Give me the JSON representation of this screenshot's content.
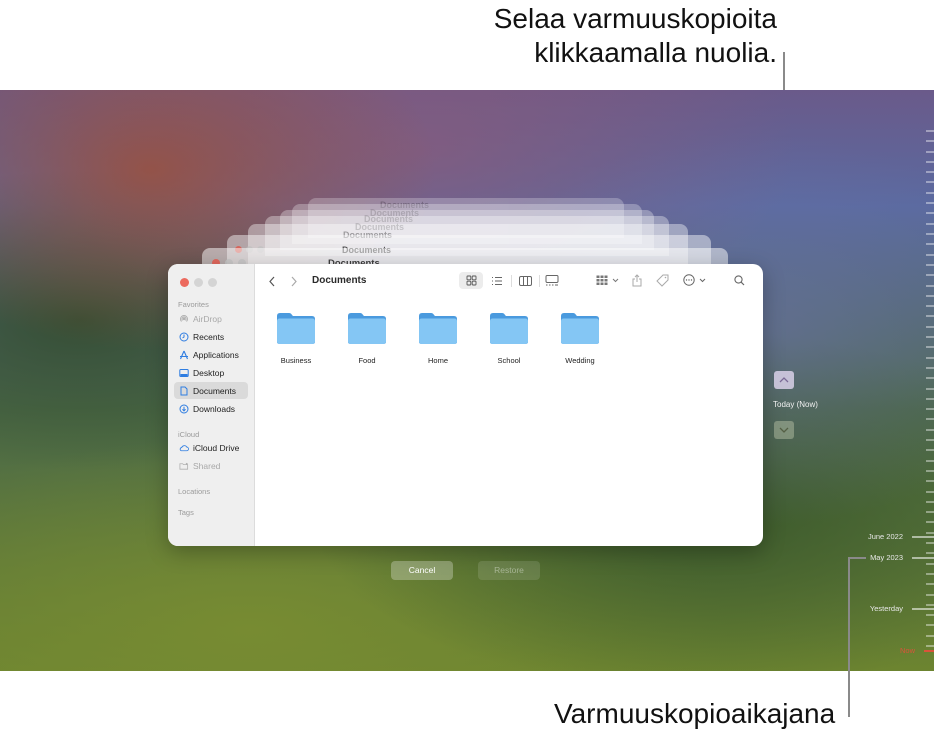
{
  "annotations": {
    "top_callout": [
      "Selaa varmuuskopioita",
      "klikkaamalla nuolia."
    ],
    "bottom_callout": "Varmuuskopioaikajana"
  },
  "background_stack": {
    "window_title": "Documents",
    "ghost_count": 6
  },
  "finder": {
    "window_controls": [
      {
        "name": "close",
        "color": "#ec6a5e"
      },
      {
        "name": "minimize",
        "color": "#d4d4d4"
      },
      {
        "name": "zoom",
        "color": "#d4d4d4"
      }
    ],
    "title": "Documents",
    "toolbar": {
      "back_icon": "chevron-left",
      "forward_icon": "chevron-right",
      "view_modes": [
        "icon-view",
        "list-view",
        "column-view",
        "gallery-view"
      ],
      "active_view": "icon-view",
      "group_icon": "grid-group",
      "share_icon": "share",
      "tag_icon": "tag",
      "more_icon": "ellipsis-circle",
      "search_icon": "magnifying-glass"
    },
    "sidebar": {
      "sections": [
        {
          "label": "Favorites",
          "items": [
            {
              "label": "AirDrop",
              "icon": "airdrop",
              "dim": true
            },
            {
              "label": "Recents",
              "icon": "clock"
            },
            {
              "label": "Applications",
              "icon": "app-store"
            },
            {
              "label": "Desktop",
              "icon": "desktop"
            },
            {
              "label": "Documents",
              "icon": "document",
              "selected": true
            },
            {
              "label": "Downloads",
              "icon": "download"
            }
          ]
        },
        {
          "label": "iCloud",
          "items": [
            {
              "label": "iCloud Drive",
              "icon": "cloud"
            },
            {
              "label": "Shared",
              "icon": "shared-folder",
              "dim": true
            }
          ]
        },
        {
          "label": "Locations",
          "items": []
        },
        {
          "label": "Tags",
          "items": []
        }
      ]
    },
    "folders": [
      "Business",
      "Food",
      "Home",
      "School",
      "Wedding"
    ],
    "folder_color": "#6bb8ee"
  },
  "buttons": {
    "cancel": "Cancel",
    "restore": "Restore",
    "restore_enabled": false
  },
  "time_machine": {
    "up_arrow_label": "chevron-up",
    "down_arrow_label": "chevron-down",
    "current_snapshot": "Today (Now)",
    "timeline": [
      {
        "label": "June 2022"
      },
      {
        "label": "May 2023"
      },
      {
        "label": "Yesterday"
      },
      {
        "label": "Now",
        "color": "#d9543a"
      }
    ]
  }
}
